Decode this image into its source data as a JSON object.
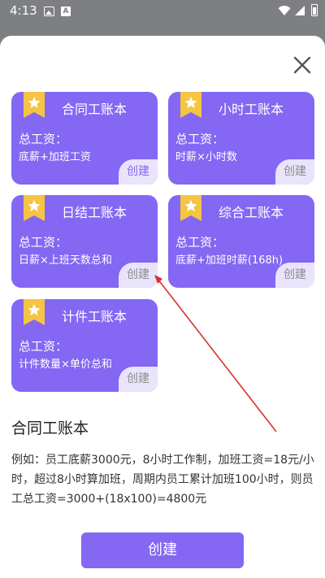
{
  "status_bar": {
    "time": "4:13",
    "icons": [
      "image-icon",
      "a-icon",
      "wifi-icon",
      "signal-icon",
      "battery-icon"
    ]
  },
  "colors": {
    "accent": "#8467f3",
    "create_chip_bg": "#e9e4fb",
    "star": "#f5c542",
    "annotation": "#d9302a"
  },
  "cards": [
    {
      "title": "合同工账本",
      "salary_label": "总工资：",
      "formula": "底薪+加班工资",
      "create_label": "创建",
      "selected": true
    },
    {
      "title": "小时工账本",
      "salary_label": "总工资：",
      "formula": "时薪×小时数",
      "create_label": "创建",
      "selected": false
    },
    {
      "title": "日结工账本",
      "salary_label": "总工资：",
      "formula": "日薪×上班天数总和",
      "create_label": "创建",
      "selected": false
    },
    {
      "title": "综合工账本",
      "salary_label": "总工资：",
      "formula": "底薪+加班时薪(168h)",
      "create_label": "创建",
      "selected": false
    },
    {
      "title": "计件工账本",
      "salary_label": "总工资：",
      "formula": "计件数量×单价总和",
      "create_label": "创建",
      "selected": false
    }
  ],
  "detail": {
    "title": "合同工账本",
    "description": "例如：员工底薪3000元，8小时工作制，加班工资=18元/小时，超过8小时算加班，周期内员工累计加班100小时，则员工总工资=3000+(18x100)=4800元"
  },
  "create_button": {
    "label": "创建"
  }
}
